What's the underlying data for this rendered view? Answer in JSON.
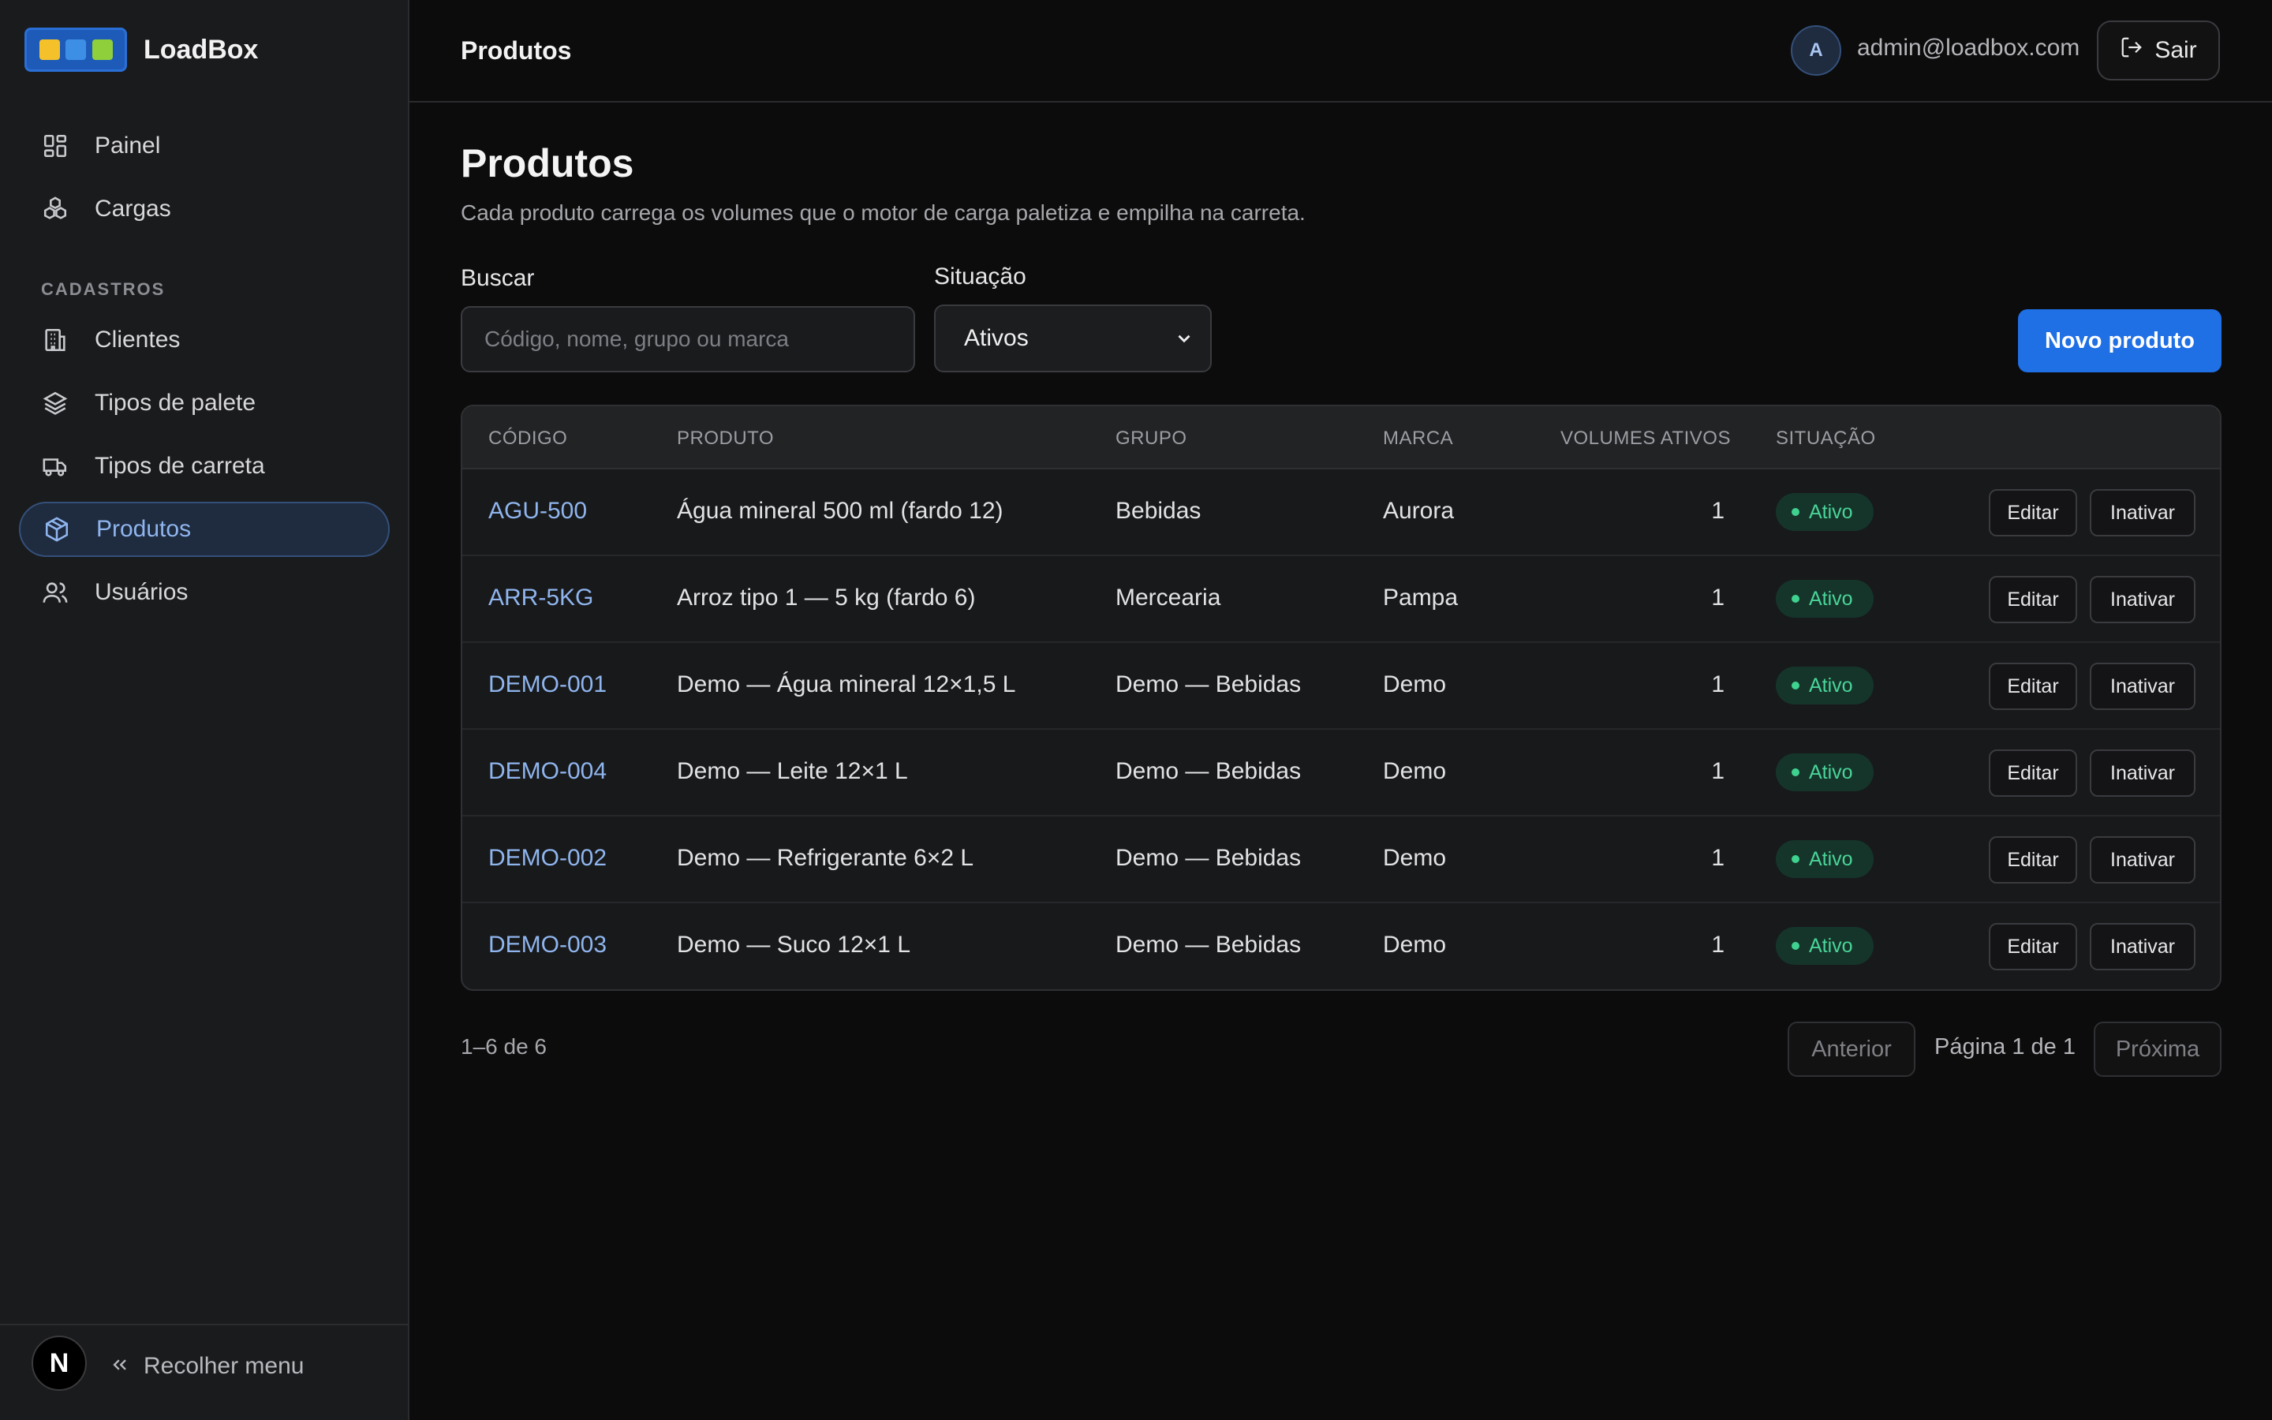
{
  "app": {
    "name": "LoadBox"
  },
  "sidebar": {
    "items": [
      {
        "label": "Painel",
        "icon": "dashboard-icon"
      },
      {
        "label": "Cargas",
        "icon": "boxes-icon"
      }
    ],
    "section_label": "CADASTROS",
    "section_items": [
      {
        "label": "Clientes",
        "icon": "building-icon"
      },
      {
        "label": "Tipos de palete",
        "icon": "layers-icon"
      },
      {
        "label": "Tipos de carreta",
        "icon": "truck-icon"
      },
      {
        "label": "Produtos",
        "icon": "package-icon",
        "active": true
      },
      {
        "label": "Usuários",
        "icon": "users-icon"
      }
    ],
    "footer": {
      "badge": "N",
      "collapse_label": "Recolher menu"
    }
  },
  "header": {
    "title": "Produtos",
    "avatar_initial": "A",
    "user_email": "admin@loadbox.com",
    "logout_label": "Sair"
  },
  "main": {
    "title": "Produtos",
    "subtitle": "Cada produto carrega os volumes que o motor de carga paletiza e empilha na carreta.",
    "search": {
      "label": "Buscar",
      "placeholder": "Código, nome, grupo ou marca",
      "value": ""
    },
    "status_filter": {
      "label": "Situação",
      "value": "Ativos"
    },
    "new_button": "Novo produto"
  },
  "table": {
    "columns": [
      "CÓDIGO",
      "PRODUTO",
      "GRUPO",
      "MARCA",
      "VOLUMES ATIVOS",
      "SITUAÇÃO"
    ],
    "rows": [
      {
        "code": "AGU-500",
        "product": "Água mineral 500 ml (fardo 12)",
        "group": "Bebidas",
        "brand": "Aurora",
        "volumes": "1",
        "status": "Ativo"
      },
      {
        "code": "ARR-5KG",
        "product": "Arroz tipo 1 — 5 kg (fardo 6)",
        "group": "Mercearia",
        "brand": "Pampa",
        "volumes": "1",
        "status": "Ativo"
      },
      {
        "code": "DEMO-001",
        "product": "Demo — Água mineral 12×1,5 L",
        "group": "Demo — Bebidas",
        "brand": "Demo",
        "volumes": "1",
        "status": "Ativo"
      },
      {
        "code": "DEMO-004",
        "product": "Demo — Leite 12×1 L",
        "group": "Demo — Bebidas",
        "brand": "Demo",
        "volumes": "1",
        "status": "Ativo"
      },
      {
        "code": "DEMO-002",
        "product": "Demo — Refrigerante 6×2 L",
        "group": "Demo — Bebidas",
        "brand": "Demo",
        "volumes": "1",
        "status": "Ativo"
      },
      {
        "code": "DEMO-003",
        "product": "Demo — Suco 12×1 L",
        "group": "Demo — Bebidas",
        "brand": "Demo",
        "volumes": "1",
        "status": "Ativo"
      }
    ],
    "edit_label": "Editar",
    "deactivate_label": "Inativar"
  },
  "pagination": {
    "count": "1–6 de 6",
    "prev": "Anterior",
    "info": "Página 1 de 1",
    "next": "Próxima"
  },
  "colors": {
    "accent": "#1f6fe5",
    "link": "#8fb5ee",
    "status_active": "#4ad498",
    "background": "#0c0c0d",
    "sidebar": "#1a1b1d"
  }
}
